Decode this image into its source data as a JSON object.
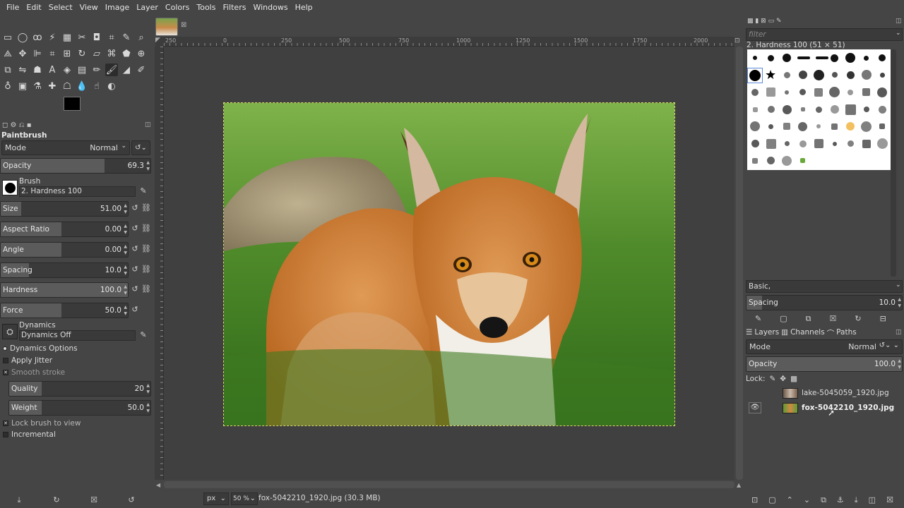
{
  "menu": [
    "File",
    "Edit",
    "Select",
    "View",
    "Image",
    "Layer",
    "Colors",
    "Tools",
    "Filters",
    "Windows",
    "Help"
  ],
  "tool_options": {
    "title": "Paintbrush",
    "mode_label": "Mode",
    "mode_value": "Normal",
    "opacity_label": "Opacity",
    "opacity_value": "69.3",
    "opacity_fraction": 0.693,
    "brush_label": "Brush",
    "brush_name": "2. Hardness 100",
    "size_label": "Size",
    "size_value": "51.00",
    "aspect_label": "Aspect Ratio",
    "aspect_value": "0.00",
    "angle_label": "Angle",
    "angle_value": "0.00",
    "spacing_label": "Spacing",
    "spacing_value": "10.0",
    "hardness_label": "Hardness",
    "hardness_value": "100.0",
    "force_label": "Force",
    "force_value": "50.0",
    "dynamics_label": "Dynamics",
    "dynamics_value": "Dynamics Off",
    "dynamics_options": "Dynamics Options",
    "apply_jitter": "Apply Jitter",
    "smooth_stroke": "Smooth stroke",
    "quality_label": "Quality",
    "quality_value": "20",
    "weight_label": "Weight",
    "weight_value": "50.0",
    "lock_brush": "Lock brush to view",
    "incremental": "Incremental"
  },
  "ruler": {
    "labels": [
      "250",
      "0",
      "250",
      "500",
      "750",
      "1000",
      "1250",
      "1500",
      "1750",
      "2000"
    ]
  },
  "status": {
    "unit": "px",
    "zoom": "50 %",
    "file_info": "fox-5042210_1920.jpg (30.3 MB)"
  },
  "brushes": {
    "filter_placeholder": "filter",
    "selected": "2. Hardness 100 (51 × 51)",
    "tag": "Basic,",
    "spacing_label": "Spacing",
    "spacing_value": "10.0"
  },
  "layers": {
    "tabs": [
      "Layers",
      "Channels",
      "Paths"
    ],
    "mode_label": "Mode",
    "mode_value": "Normal",
    "opacity_label": "Opacity",
    "opacity_value": "100.0",
    "lock_label": "Lock:",
    "items": [
      {
        "name": "lake-5045059_1920.jpg",
        "visible": false
      },
      {
        "name": "fox-5042210_1920.jpg",
        "visible": true
      }
    ]
  },
  "colors": {
    "fg": "#000000",
    "bg": "#ffffff",
    "selection": "#d8d866"
  }
}
